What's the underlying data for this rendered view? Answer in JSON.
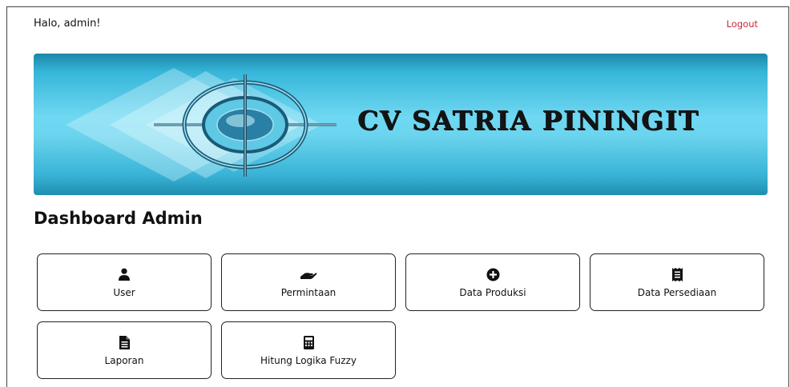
{
  "header": {
    "greeting": "Halo, admin!",
    "logout_label": "Logout"
  },
  "banner": {
    "company_name": "CV SATRIA PININGIT"
  },
  "dashboard": {
    "title": "Dashboard Admin",
    "cards": [
      {
        "label": "User",
        "icon": "user-icon"
      },
      {
        "label": "Permintaan",
        "icon": "hand-holding-icon"
      },
      {
        "label": "Data Produksi",
        "icon": "plus-circle-icon"
      },
      {
        "label": "Data Persediaan",
        "icon": "receipt-icon"
      },
      {
        "label": "Laporan",
        "icon": "file-document-icon"
      },
      {
        "label": "Hitung Logika Fuzzy",
        "icon": "calculator-icon"
      }
    ]
  },
  "colors": {
    "logout": "#c6283a",
    "banner_primary": "#36b6d9",
    "banner_light": "#6fd8f2"
  }
}
